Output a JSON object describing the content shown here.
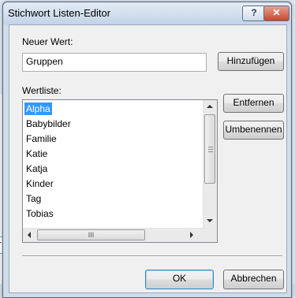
{
  "window": {
    "title": "Stichwort Listen-Editor"
  },
  "titlebar": {
    "help_glyph": "?",
    "close_glyph": "✕"
  },
  "background": {
    "partial_text": "er"
  },
  "new_value": {
    "label": "Neuer Wert:",
    "value": "Gruppen",
    "add_button": "Hinzufügen"
  },
  "value_list": {
    "label": "Wertliste:",
    "items": [
      "Alpha",
      "Babybilder",
      "Familie",
      "Katie",
      "Katja",
      "Kinder",
      "Tag",
      "Tobias"
    ],
    "selected": "Alpha",
    "hscroll_grip": "III"
  },
  "actions": {
    "remove_button": "Entfernen",
    "rename_button": "Umbenennen"
  },
  "footer": {
    "ok_button": "OK",
    "cancel_button": "Abbrechen"
  },
  "colors": {
    "selection": "#3399ff",
    "close_button": "#c8462e",
    "titlebar": "#c3d3e6"
  }
}
